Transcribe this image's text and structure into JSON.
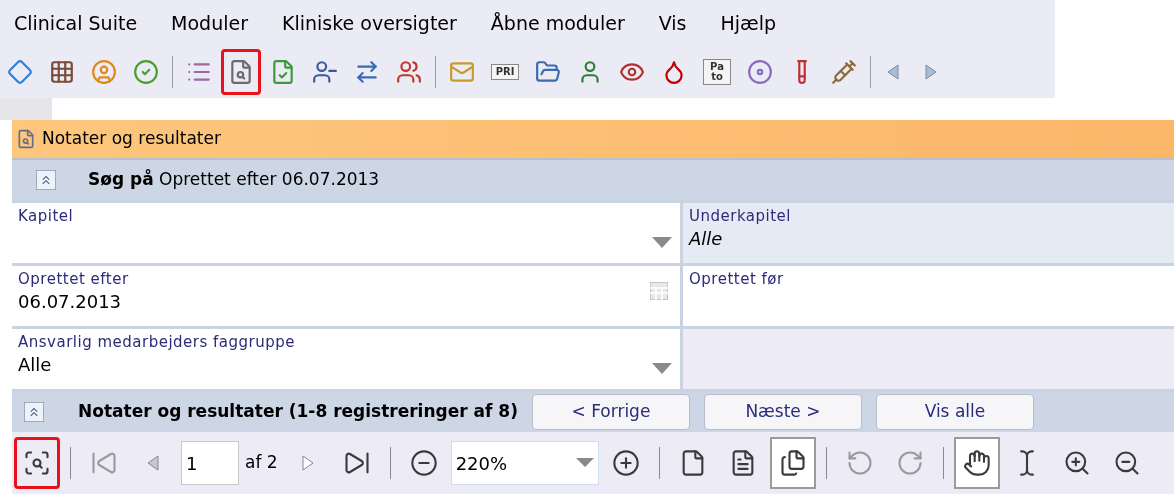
{
  "menu": [
    "Clinical Suite",
    "Moduler",
    "Kliniske oversigter",
    "Åbne moduler",
    "Vis",
    "Hjælp"
  ],
  "toolbar": [
    {
      "kind": "diamond",
      "highlighted": false
    },
    {
      "kind": "calendar",
      "highlighted": false
    },
    {
      "kind": "badge",
      "highlighted": false
    },
    {
      "kind": "badge-check",
      "highlighted": false
    },
    {
      "kind": "separator"
    },
    {
      "kind": "list",
      "highlighted": false
    },
    {
      "kind": "page-search",
      "highlighted": true
    },
    {
      "kind": "page-check",
      "highlighted": false
    },
    {
      "kind": "person-minus",
      "highlighted": false
    },
    {
      "kind": "arrows",
      "highlighted": false
    },
    {
      "kind": "people",
      "highlighted": false
    },
    {
      "kind": "separator"
    },
    {
      "kind": "mail",
      "highlighted": false
    },
    {
      "kind": "label",
      "text": "PRI",
      "highlighted": false
    },
    {
      "kind": "folder",
      "highlighted": false
    },
    {
      "kind": "doctor",
      "highlighted": false
    },
    {
      "kind": "eye",
      "highlighted": false
    },
    {
      "kind": "drop",
      "highlighted": false
    },
    {
      "kind": "label",
      "text": "Pa to",
      "highlighted": false
    },
    {
      "kind": "disc",
      "highlighted": false
    },
    {
      "kind": "tube",
      "highlighted": false
    },
    {
      "kind": "syringe",
      "highlighted": false
    },
    {
      "kind": "separator"
    },
    {
      "kind": "back",
      "highlighted": false
    },
    {
      "kind": "forward",
      "highlighted": false
    }
  ],
  "panel": {
    "title": "Notater og resultater",
    "search_header": "**Søg på** Oprettet efter 06.07.2013",
    "fields": [
      {
        "kind": "dropdown",
        "label": "Kapitel"
      },
      {
        "kind": "display",
        "label": "Underkapitel",
        "value": "Alle"
      },
      {
        "kind": "date",
        "label": "Oprettet efter",
        "value": "06.07.2013"
      },
      {
        "kind": "display",
        "label": "Oprettet før"
      },
      {
        "kind": "dropdown",
        "label": "Ansvarlig medarbejders faggruppe",
        "value": "Alle"
      },
      {
        "kind": "empty"
      }
    ],
    "results_header": {
      "title": "Notater og resultater (1-8 registreringer af 8)",
      "buttons": [
        "< Forrige",
        "Næste >",
        "Vis alle"
      ]
    },
    "viewer_toolbar": [
      {
        "kind": "search-page",
        "highlighted": true,
        "selected": false
      },
      {
        "kind": "separator"
      },
      {
        "kind": "first",
        "highlighted": false,
        "selected": false
      },
      {
        "kind": "prev",
        "highlighted": false,
        "selected": false
      },
      {
        "kind": "page-input",
        "value": "1"
      },
      {
        "kind": "page-count",
        "text": "af 2"
      },
      {
        "kind": "next",
        "highlighted": false,
        "selected": false
      },
      {
        "kind": "last",
        "highlighted": false,
        "selected": false
      },
      {
        "kind": "separator"
      },
      {
        "kind": "zoom-minus",
        "highlighted": false,
        "selected": false
      },
      {
        "kind": "zoom-select",
        "value": "220%"
      },
      {
        "kind": "zoom-plus",
        "highlighted": false,
        "selected": false
      },
      {
        "kind": "separator"
      },
      {
        "kind": "single-page",
        "highlighted": false,
        "selected": false
      },
      {
        "kind": "fit-page",
        "highlighted": false,
        "selected": false
      },
      {
        "kind": "fit-width",
        "highlighted": false,
        "selected": true
      },
      {
        "kind": "separator"
      },
      {
        "kind": "rotate-left",
        "highlighted": false,
        "selected": false
      },
      {
        "kind": "rotate-right",
        "highlighted": false,
        "selected": false
      },
      {
        "kind": "separator"
      },
      {
        "kind": "hand",
        "highlighted": false,
        "selected": true
      },
      {
        "kind": "text-select",
        "highlighted": false,
        "selected": false
      },
      {
        "kind": "magnify-plus",
        "highlighted": false,
        "selected": false
      },
      {
        "kind": "magnify-minus",
        "highlighted": false,
        "selected": false
      }
    ]
  }
}
